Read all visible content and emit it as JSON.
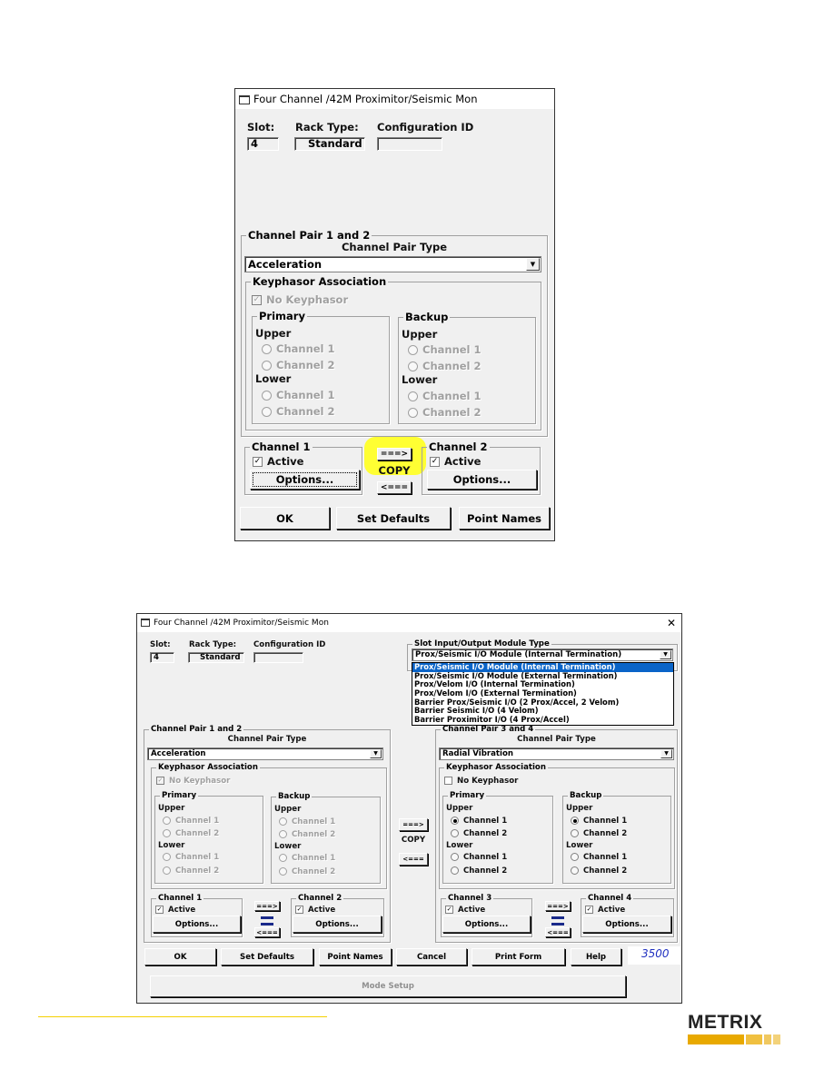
{
  "dialog_top": {
    "title": "Four Channel /42M Proximitor/Seismic Mon",
    "slot_label": "Slot:",
    "slot_value": "4",
    "rack_type_label": "Rack Type:",
    "rack_type_value": "Standard",
    "config_id_label": "Configuration ID",
    "config_id_value": "",
    "pair": {
      "legend": "Channel Pair 1 and 2",
      "type_label": "Channel Pair Type",
      "type_value": "Acceleration",
      "keyphasor_legend": "Keyphasor Association",
      "no_keyphasor": "No Keyphasor",
      "no_keyphasor_checked": true,
      "primary": "Primary",
      "backup": "Backup",
      "upper": "Upper",
      "lower": "Lower",
      "ch1": "Channel 1",
      "ch2": "Channel 2"
    },
    "channel1": {
      "legend": "Channel 1",
      "active": "Active",
      "options": "Options..."
    },
    "channel2": {
      "legend": "Channel 2",
      "active": "Active",
      "options": "Options..."
    },
    "copy_right": "===>",
    "copy_label": "COPY",
    "copy_left": "<===",
    "highlight_color": "#ffff33",
    "buttons": {
      "ok": "OK",
      "set_defaults": "Set Defaults",
      "point_names": "Point Names"
    }
  },
  "dialog_bottom": {
    "title": "Four Channel /42M Proximitor/Seismic Mon",
    "close": "✕",
    "slot_label": "Slot:",
    "slot_value": "4",
    "rack_type_label": "Rack Type:",
    "rack_type_value": "Standard",
    "config_id_label": "Configuration ID",
    "config_id_value": "",
    "io_module": {
      "legend": "Slot Input/Output Module Type",
      "selected": "Prox/Seismic I/O Module (Internal Termination)",
      "options": [
        "Prox/Seismic I/O Module (Internal Termination)",
        "Prox/Seismic I/O Module (External Termination)",
        "Prox/Velom I/O (Internal Termination)",
        "Prox/Velom I/O (External Termination)",
        "Barrier Prox/Seismic I/O (2 Prox/Accel, 2 Velom)",
        "Barrier Seismic I/O (4 Velom)",
        "Barrier Proximitor I/O (4 Prox/Accel)"
      ]
    },
    "pair12": {
      "legend": "Channel Pair 1 and 2",
      "type_label": "Channel Pair Type",
      "type_value": "Acceleration",
      "keyphasor_legend": "Keyphasor Association",
      "no_keyphasor": "No Keyphasor",
      "primary": "Primary",
      "backup": "Backup",
      "upper": "Upper",
      "lower": "Lower",
      "ch1": "Channel 1",
      "ch2": "Channel 2"
    },
    "pair34": {
      "legend": "Channel Pair 3 and 4",
      "type_label": "Channel Pair Type",
      "type_value": "Radial Vibration",
      "keyphasor_legend": "Keyphasor Association",
      "no_keyphasor": "No Keyphasor",
      "primary": "Primary",
      "backup": "Backup",
      "upper": "Upper",
      "lower": "Lower",
      "ch1": "Channel 1",
      "ch2": "Channel 2"
    },
    "channels": [
      {
        "legend": "Channel 1",
        "active": "Active",
        "options": "Options..."
      },
      {
        "legend": "Channel 2",
        "active": "Active",
        "options": "Options..."
      },
      {
        "legend": "Channel 3",
        "active": "Active",
        "options": "Options..."
      },
      {
        "legend": "Channel 4",
        "active": "Active",
        "options": "Options..."
      }
    ],
    "copy_right": "===>",
    "copy_label": "COPY",
    "copy_left": "<===",
    "buttons": {
      "ok": "OK",
      "set_defaults": "Set Defaults",
      "point_names": "Point Names",
      "cancel": "Cancel",
      "print_form": "Print Form",
      "help": "Help",
      "mode_setup": "Mode Setup"
    },
    "version": "3500"
  },
  "footer": {
    "logo": "METRIX",
    "rule_color": "#f5d000",
    "logo_color": "#e8a900"
  }
}
